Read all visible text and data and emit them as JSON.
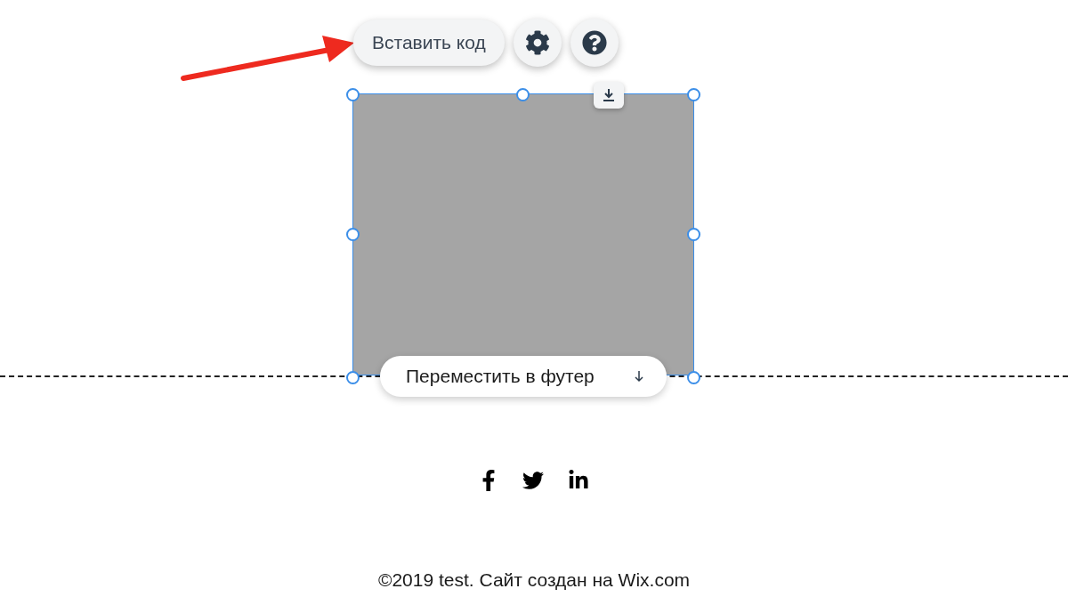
{
  "toolbar": {
    "embed_button": "Вставить код"
  },
  "selection": {
    "move_button": "Переместить в футер"
  },
  "footer": {
    "copyright": "©2019 test. Сайт создан на Wix.com"
  }
}
